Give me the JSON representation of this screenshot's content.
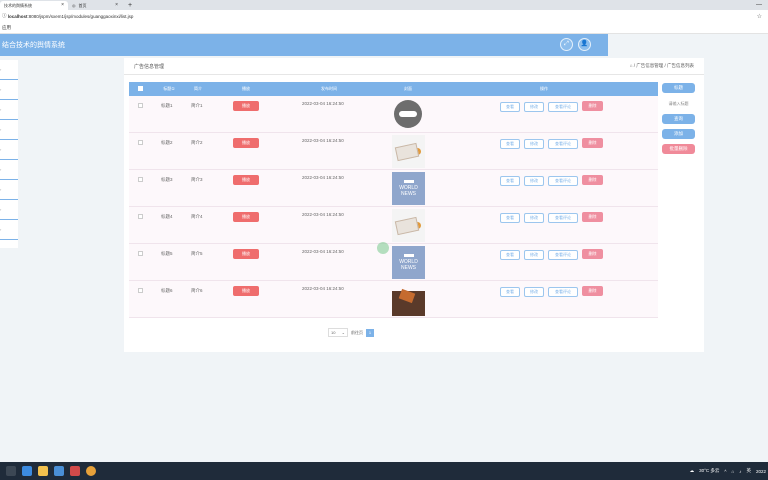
{
  "browser": {
    "tabs": [
      {
        "label": "技术的舆情系统",
        "active": true
      },
      {
        "label": "首页",
        "active": false
      }
    ],
    "new_tab": "+",
    "address": {
      "prefix": "localhost",
      "rest": ":8080/jspm/sxem1/jsp/modules/guanggaoxinxi/list.jsp"
    },
    "bookmark": "应用"
  },
  "app": {
    "title": "结合技术的舆情系统",
    "header_btn1": "⤢",
    "header_btn2": "👤"
  },
  "panel": {
    "title": "广告信息管理",
    "breadcrumb": "⌂ / 广告信息管理 / 广告信息列表"
  },
  "table": {
    "headers": [
      "标题①",
      "简介",
      "播放",
      "发布时间",
      "封面",
      "操作"
    ],
    "rows": [
      {
        "title": "标题1",
        "intro": "简介1",
        "play": "播放",
        "time": "2022-03-04 16:24:50",
        "thumb": "globe"
      },
      {
        "title": "标题2",
        "intro": "简介2",
        "play": "播放",
        "time": "2022-03-04 16:24:50",
        "thumb": "paper"
      },
      {
        "title": "标题3",
        "intro": "简介3",
        "play": "播放",
        "time": "2022-03-04 16:24:50",
        "thumb": "worldnews"
      },
      {
        "title": "标题4",
        "intro": "简介4",
        "play": "播放",
        "time": "2022-03-04 16:24:50",
        "thumb": "paper"
      },
      {
        "title": "标题5",
        "intro": "简介5",
        "play": "播放",
        "time": "2022-03-04 16:24:50",
        "thumb": "worldnews"
      },
      {
        "title": "标题6",
        "intro": "简介6",
        "play": "播放",
        "time": "2022-03-04 16:24:50",
        "thumb": "dark"
      }
    ],
    "actions": [
      "查看",
      "修改",
      "查看评论",
      "删除"
    ]
  },
  "sidepanel": {
    "search_label": "标题",
    "search_placeholder": "请输入标题",
    "query_btn": "查询",
    "add_btn": "添加",
    "batch_delete_btn": "批量删除"
  },
  "pager": {
    "page_size": "10",
    "goto_label": "前往页",
    "current_page": "1"
  },
  "taskbar": {
    "weather": "30°C 多云",
    "lang": "英",
    "time": "2022"
  },
  "colors": {
    "primary": "#7cb2e8",
    "danger": "#ef6d6d",
    "row_bg": "#fdf8fb"
  }
}
